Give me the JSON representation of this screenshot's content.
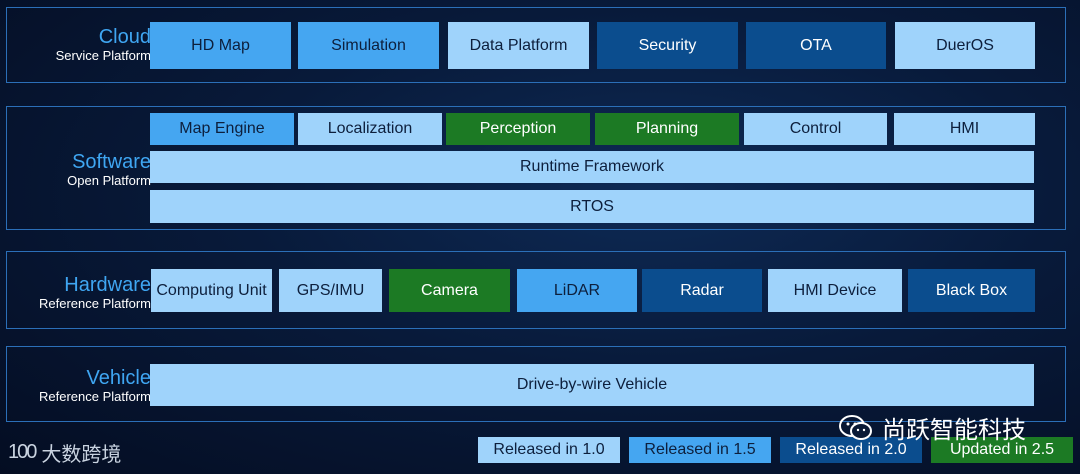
{
  "cloud": {
    "title": "Cloud",
    "subtitle": "Service Platform",
    "items": [
      {
        "label": "HD Map",
        "status": "c15"
      },
      {
        "label": "Simulation",
        "status": "c15"
      },
      {
        "label": "Data Platform",
        "status": "c10"
      },
      {
        "label": "Security",
        "status": "c20"
      },
      {
        "label": "OTA",
        "status": "c20"
      },
      {
        "label": "DuerOS",
        "status": "c10"
      }
    ]
  },
  "software": {
    "title": "Software",
    "subtitle": "Open Platform",
    "items": [
      {
        "label": "Map Engine",
        "status": "c15"
      },
      {
        "label": "Localization",
        "status": "c10"
      },
      {
        "label": "Perception",
        "status": "c25"
      },
      {
        "label": "Planning",
        "status": "c25"
      },
      {
        "label": "Control",
        "status": "c10"
      },
      {
        "label": "HMI",
        "status": "c10"
      }
    ],
    "runtime": "Runtime Framework",
    "rtos": "RTOS"
  },
  "hardware": {
    "title": "Hardware",
    "subtitle": "Reference Platform",
    "items": [
      {
        "label": "Computing Unit",
        "status": "c10"
      },
      {
        "label": "GPS/IMU",
        "status": "c10"
      },
      {
        "label": "Camera",
        "status": "c25"
      },
      {
        "label": "LiDAR",
        "status": "c15"
      },
      {
        "label": "Radar",
        "status": "c20"
      },
      {
        "label": "HMI Device",
        "status": "c10"
      },
      {
        "label": "Black Box",
        "status": "c20"
      }
    ]
  },
  "vehicle": {
    "title": "Vehicle",
    "subtitle": "Reference Platform",
    "item": "Drive-by-wire Vehicle"
  },
  "legend": [
    {
      "label": "Released in 1.0",
      "status": "c10"
    },
    {
      "label": "Released in 1.5",
      "status": "c15"
    },
    {
      "label": "Released in 2.0",
      "status": "c20"
    },
    {
      "label": "Updated in 2.5",
      "status": "c25"
    }
  ],
  "colors": {
    "released_1_0": "#9fd3fb",
    "released_1_5": "#45a6f1",
    "released_2_0": "#0b4d8e",
    "updated_2_5": "#1c7a24",
    "title_accent": "#3fa6f2",
    "border": "#2b6fb8"
  },
  "watermark_left": {
    "logo": "100",
    "text": "大数跨境"
  },
  "watermark_right": {
    "icon": "wechat-icon",
    "text": "尚跃智能科技"
  }
}
